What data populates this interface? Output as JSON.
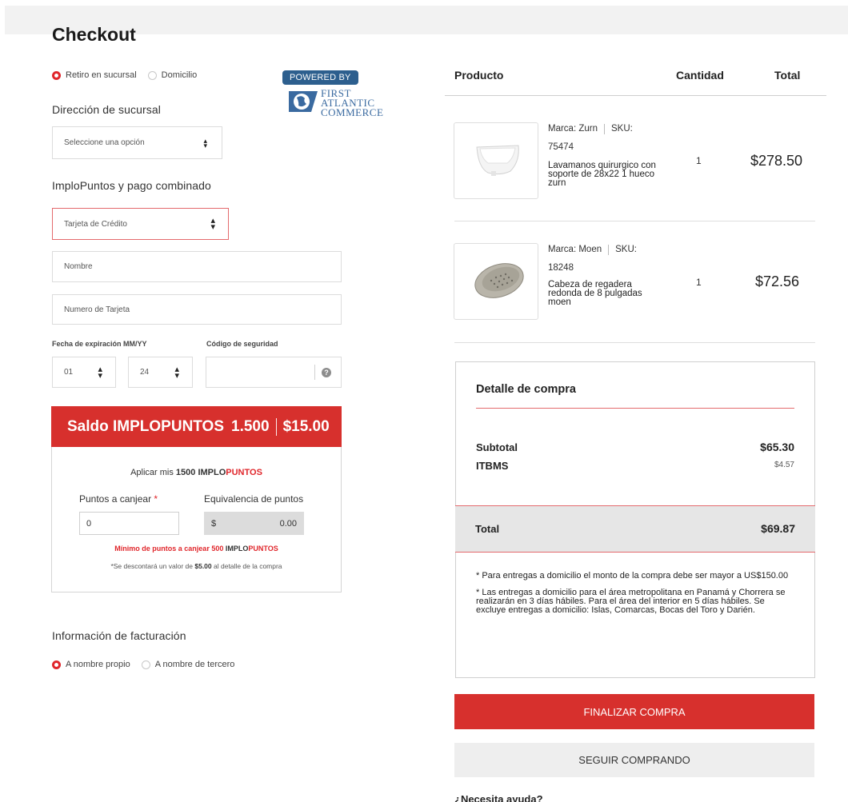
{
  "page": {
    "title": "Checkout"
  },
  "delivery": {
    "options": [
      {
        "label": "Retiro en sucursal",
        "selected": true
      },
      {
        "label": "Domicilio",
        "selected": false
      }
    ]
  },
  "logo": {
    "badge": "POWERED BY",
    "line1": "FIRST",
    "line2": "ATLANTIC",
    "line3": "COMMERCE"
  },
  "branch": {
    "title": "Dirección de sucursal",
    "select_value": "Seleccione una opción"
  },
  "payment": {
    "title": "ImploPuntos y pago combinado",
    "method_value": "Tarjeta de Crédito",
    "name_placeholder": "Nombre",
    "card_placeholder": "Numero de Tarjeta",
    "expiry_label": "Fecha de expiración MM/YY",
    "cvv_label": "Código de seguridad",
    "month_value": "01",
    "year_value": "24",
    "help_glyph": "?"
  },
  "implopuntos": {
    "header_label": "Saldo IMPLOPUNTOS",
    "header_points": "1.500",
    "header_amount": "$15.00",
    "apply_prefix": "Aplicar mis",
    "apply_bold": "1500 IMPLO",
    "apply_red": "PUNTOS",
    "points_label": "Puntos a canjear",
    "required_mark": "*",
    "points_value": "0",
    "equiv_label": "Equivalencia de puntos",
    "equiv_currency": "$",
    "equiv_value": "0.00",
    "min_text": "Mínimo de puntos a canjear 500",
    "min_dark": "IMPLO",
    "min_red": "PUNTOS",
    "note_prefix": "*Se descontará un valor de",
    "note_bold": "$5.00",
    "note_suffix": "al detalle de la compra"
  },
  "billing": {
    "title": "Información de facturación",
    "options": [
      {
        "label": "A nombre propio",
        "selected": true
      },
      {
        "label": "A nombre de tercero",
        "selected": false
      }
    ]
  },
  "cart": {
    "columns": [
      "Producto",
      "Cantidad",
      "Total"
    ],
    "items": [
      {
        "brand_label": "Marca: Zurn",
        "sku_label": "SKU:",
        "sku": "75474",
        "description": "Lavamanos quirurgico con soporte de 28x22 1 hueco zurn",
        "qty": "1",
        "price": "$278.50"
      },
      {
        "brand_label": "Marca: Moen",
        "sku_label": "SKU:",
        "sku": "18248",
        "description": "Cabeza de regadera redonda de 8 pulgadas moen",
        "qty": "1",
        "price": "$72.56"
      }
    ]
  },
  "summary": {
    "title": "Detalle de compra",
    "subtotal_label": "Subtotal",
    "subtotal_value": "$65.30",
    "tax_label": "ITBMS",
    "tax_value": "$4.57",
    "total_label": "Total",
    "total_value": "$69.87",
    "note1": "* Para entregas a domicilio el monto de la compra debe ser mayor a US$150.00",
    "note2": "* Las entregas a domicilio para el área metropolitana en Panamá y Chorrera se realizarán en 3 días hábiles. Para el área del interior en 5 días hábiles. Se excluye entregas a domicilio: Islas, Comarcas, Bocas del Toro y Darién."
  },
  "actions": {
    "finish": "FINALIZAR COMPRA",
    "continue": "SEGUIR COMPRANDO"
  },
  "help": {
    "title": "¿Necesita ayuda?"
  },
  "colors": {
    "accent": "#d7302d",
    "logo_blue": "#2d5f8e"
  }
}
